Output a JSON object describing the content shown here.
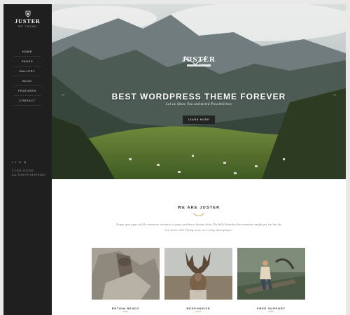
{
  "sidebar": {
    "logo_title": "JUSTER",
    "logo_sub": "WP THEME",
    "nav": [
      "HOME",
      "PAGES",
      "GALLERY",
      "BLOG",
      "FEATURES",
      "CONTACT"
    ],
    "social_icons": [
      "twitter-icon",
      "facebook-icon",
      "linkedin-icon",
      "instagram-icon"
    ],
    "copyright_line1": "© 2015 JUSTER.",
    "copyright_line2": "ALL RIGHTS RESERVED."
  },
  "hero": {
    "logo_word": "JUSTER",
    "title": "BEST WORDPRESS THEME FOREVER",
    "subtitle": "Let us Show You unlimited Possibilities",
    "button": "LEARN MORE",
    "prev_arrow": "←",
    "next_arrow": "→"
  },
  "about": {
    "heading": "WE ARE JUSTER",
    "text": "Zuqua ipsa quas ab illo inventore veritatis et quasi architecto beatae dicta The hills Someday the mountain might get 'em but the law never will. Flying away on a wing and a prayer."
  },
  "features": [
    {
      "title": "RETINA READY"
    },
    {
      "title": "RESPONSIVE"
    },
    {
      "title": "FREE SUPPORT"
    }
  ],
  "colors": {
    "sidebar_bg": "#1f1f1f",
    "button_bg": "#232323",
    "accent": "#cdb885"
  }
}
